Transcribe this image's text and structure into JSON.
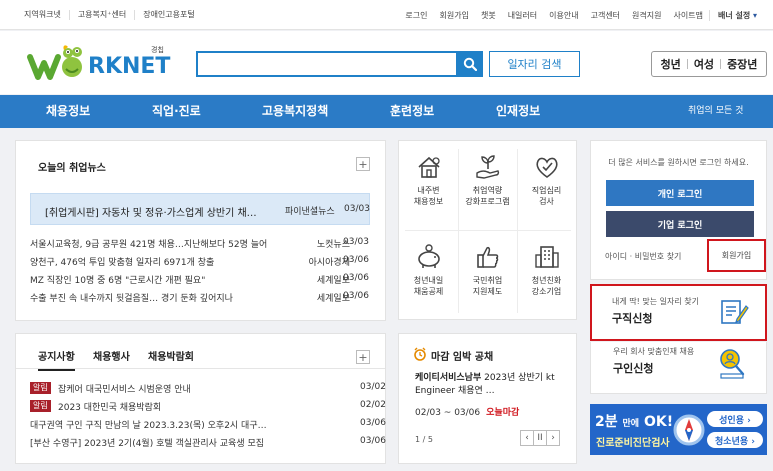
{
  "top_left_links": [
    "지역워크넷",
    "고용복지⁺센터",
    "장애인고용포털"
  ],
  "top_right_links": [
    "로그인",
    "회원가입",
    "챗봇",
    "내일러터",
    "이용안내",
    "고객센터",
    "원격지원",
    "사이트맵"
  ],
  "banner_setting": "배너 설정",
  "logo": {
    "brand": "RKNET",
    "badge": "경칩"
  },
  "search": {
    "placeholder": "",
    "job_search_label": "일자리 검색"
  },
  "target_groups": [
    "청년",
    "여성",
    "중장년"
  ],
  "nav": {
    "items": [
      "채용정보",
      "직업·진로",
      "고용복지정책",
      "훈련정보",
      "인재정보"
    ],
    "all_services": "취업의 모든 것"
  },
  "news": {
    "title": "오늘의 취업뉴스",
    "headline": {
      "text": "[취업게시판] 자동차 및 정유·가스업계 상반기 채…",
      "source": "파이낸셜뉴스",
      "date": "03/03"
    },
    "items": [
      {
        "text": "서울시교육청, 9급 공무원 421명 채용…지난해보다 52명 늘어",
        "source": "노컷뉴스",
        "date": "03/03"
      },
      {
        "text": "양천구, 476억 투입 맞춤형 일자리 6971개 창출",
        "source": "아시아경제",
        "date": "03/06"
      },
      {
        "text": "MZ 직장인 10명 중 6명 \"근로시간 개편 필요\"",
        "source": "세계일보",
        "date": "03/06"
      },
      {
        "text": "수출 부진 속 내수까지 뒷걸음질… 경기 둔화 깊어지나",
        "source": "세계일보",
        "date": "03/06"
      }
    ]
  },
  "quick_menu": [
    {
      "label": "내주변\n채용정보",
      "icon": "house-map-icon"
    },
    {
      "label": "취업역량\n강화프로그램",
      "icon": "sprout-hand-icon"
    },
    {
      "label": "직업심리\n검사",
      "icon": "heart-check-icon"
    },
    {
      "label": "청년내일\n채움공제",
      "icon": "piggy-bank-icon"
    },
    {
      "label": "국민취업\n지원제도",
      "icon": "thumbs-up-icon"
    },
    {
      "label": "청년친화\n강소기업",
      "icon": "building-icon"
    }
  ],
  "login": {
    "message": "더 많은 서비스를 원하시면 로그인 하세요.",
    "personal_login": "개인 로그인",
    "company_login": "기업 로그인",
    "find_links": "아이디 · 비밀번호 찾기",
    "signup": "회원가입"
  },
  "services": {
    "job_request": {
      "sub": "내게 딱! 맞는 일자리 찾기",
      "main": "구직신청"
    },
    "talent_request": {
      "sub": "우리 회사 맞춤인재 채용",
      "main": "구인신청"
    }
  },
  "notices": {
    "tabs": [
      "공지사항",
      "채용행사",
      "채용박람회"
    ],
    "items": [
      {
        "badge": "알림",
        "text": "잡케어 대국민서비스 시범운영 안내",
        "date": "03/02"
      },
      {
        "badge": "알림",
        "text": "2023 대한민국 채용박람회",
        "date": "02/02"
      },
      {
        "badge": "",
        "text": "대구권역 구인 구직 만남의 날 2023.3.23(목) 오후2시 대구…",
        "date": "03/06"
      },
      {
        "badge": "",
        "text": "[부산 수영구] 2023년 2기(4월) 호텔 객실관리사 교육생 모집",
        "date": "03/06"
      }
    ]
  },
  "deadline": {
    "title": "마감 임박 공채",
    "company": "케이티서비스남부",
    "desc": "2023년 상반기 kt Engineer 채용연 …",
    "date": "02/03 ~ 03/06",
    "today_label": "오늘마감",
    "page": "1 / 5",
    "pager": [
      "‹",
      "II",
      "›"
    ]
  },
  "banner": {
    "line1": "2분",
    "line1_small": "만에",
    "line1_ok": "OK!",
    "line2": "진로준비진단검사",
    "btn1": "성인용 ›",
    "btn2": "청소년용 ›"
  },
  "colors": {
    "primary": "#2b7bc6",
    "personal_login": "#2f77c2",
    "company_login": "#3b4a6b",
    "highlight": "#d0161d"
  }
}
